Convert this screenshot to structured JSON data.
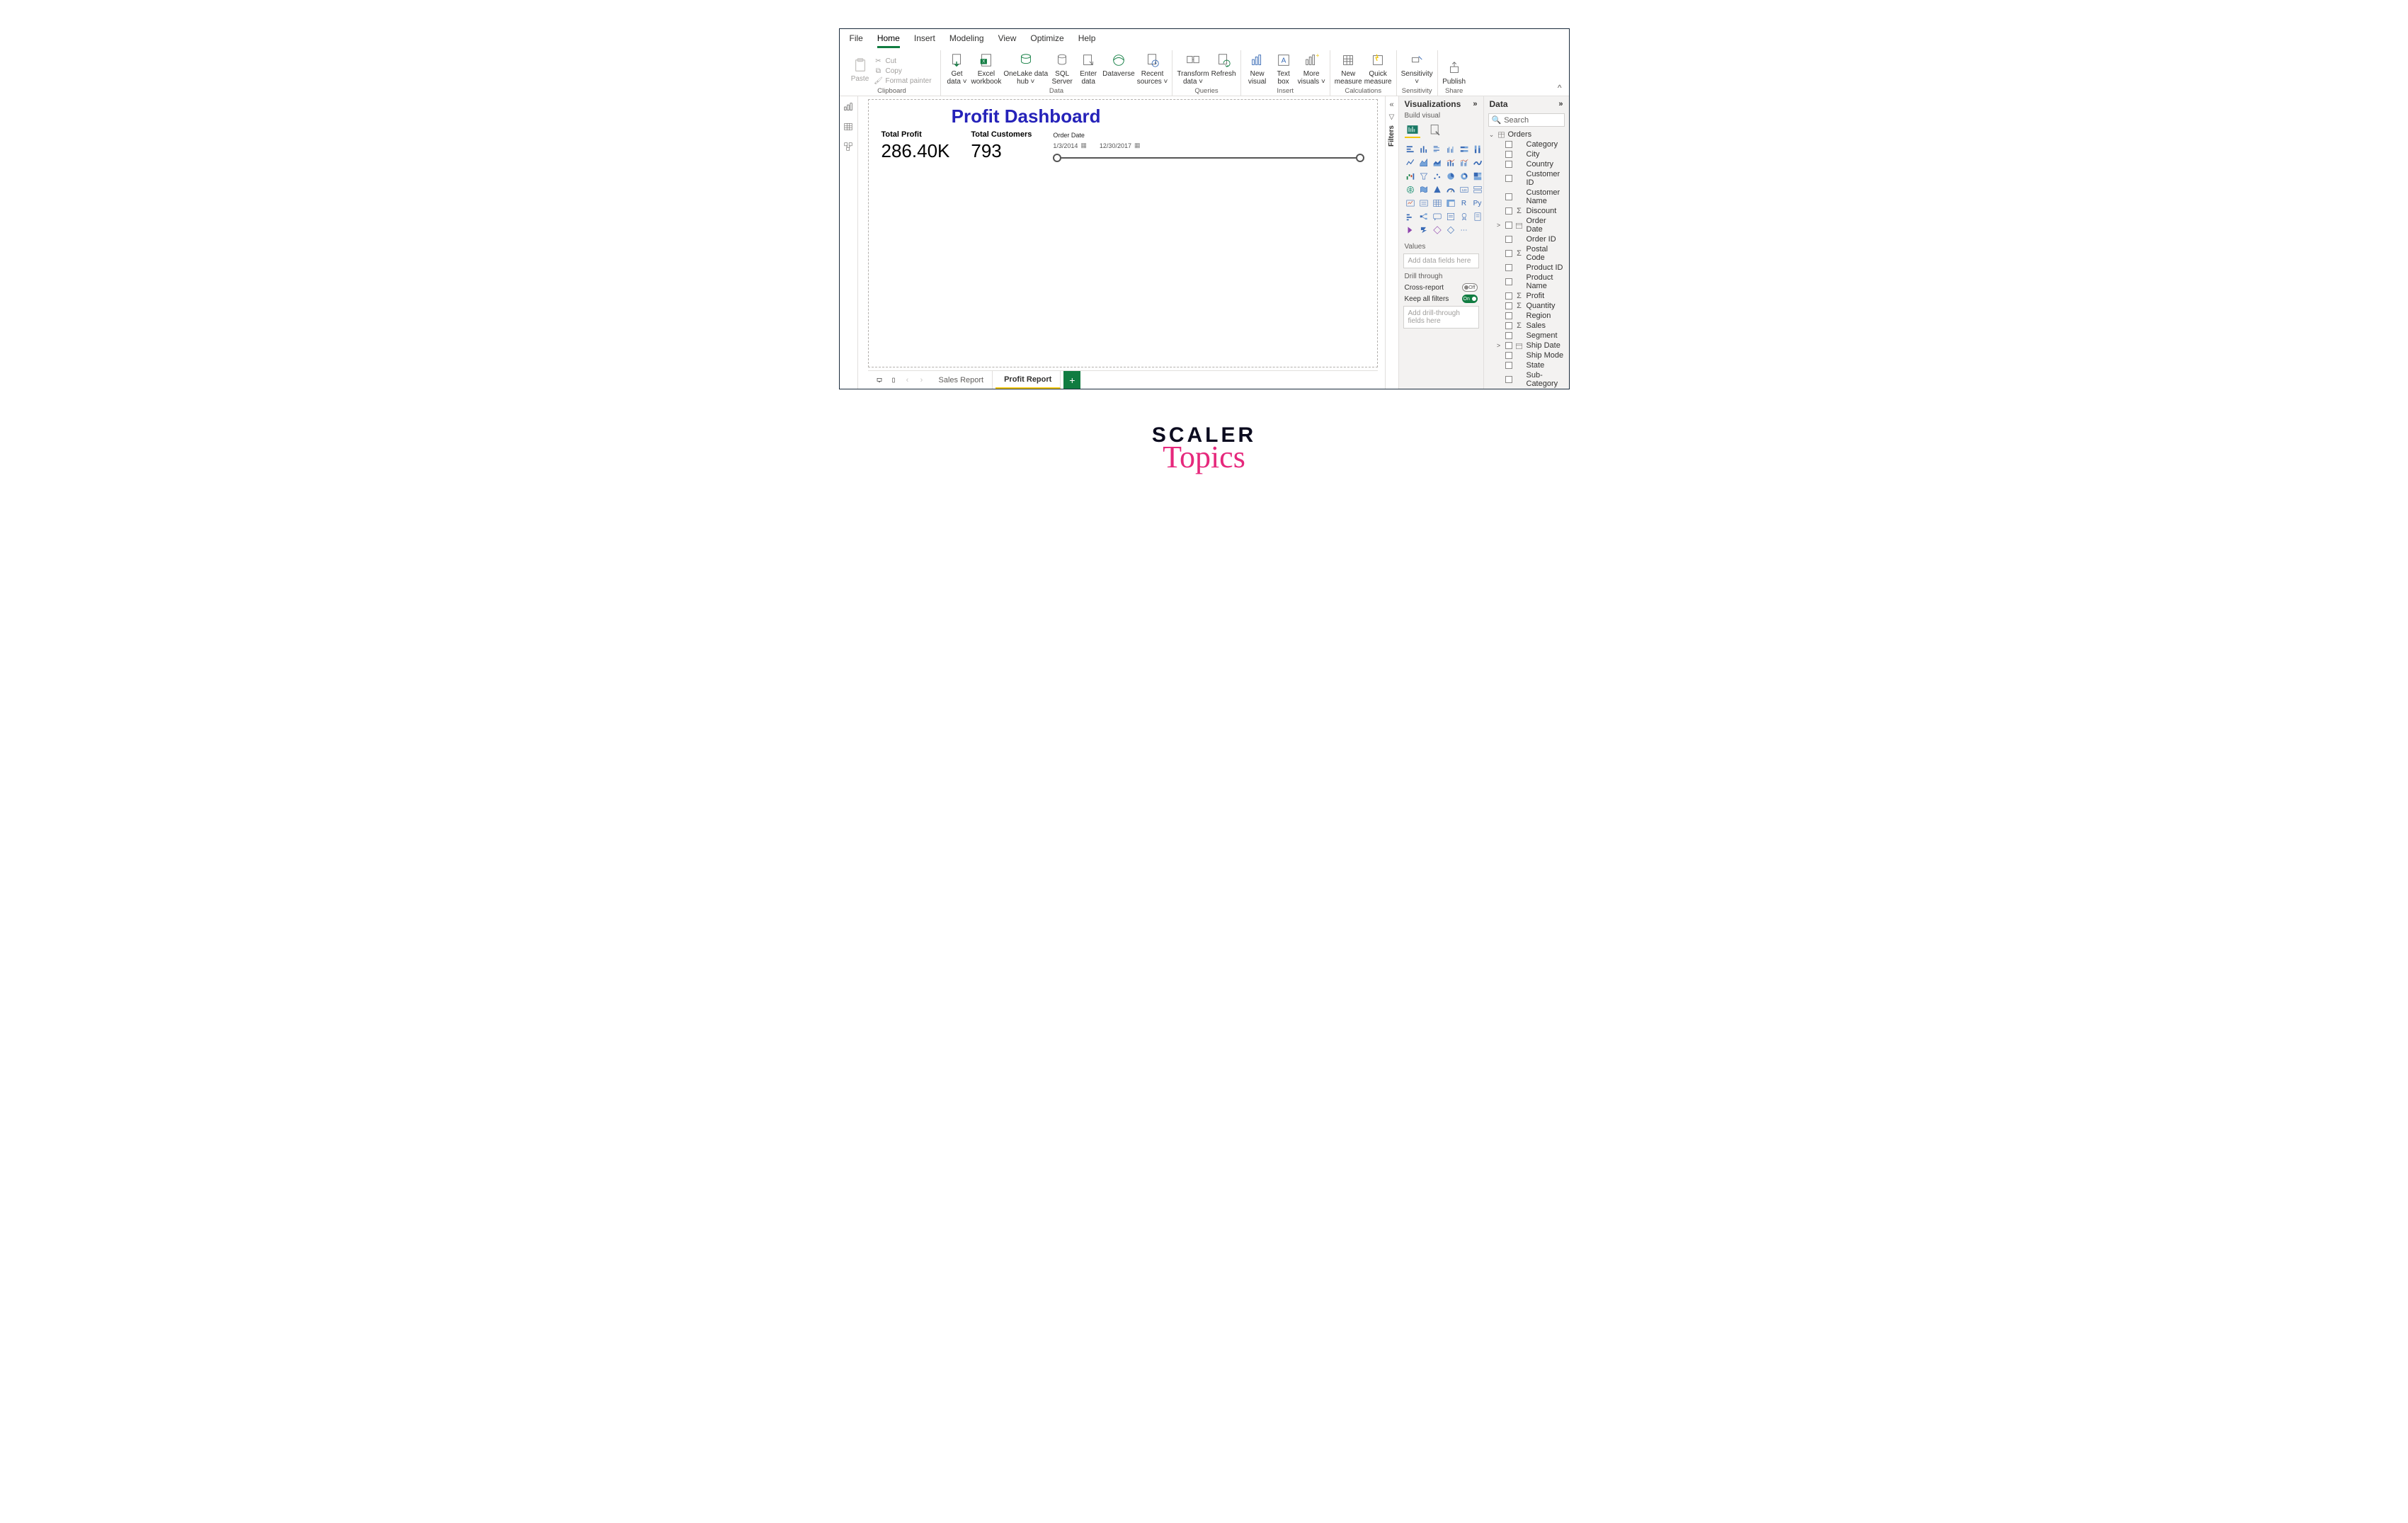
{
  "menu": {
    "tabs": [
      "File",
      "Home",
      "Insert",
      "Modeling",
      "View",
      "Optimize",
      "Help"
    ],
    "active": "Home"
  },
  "ribbon": {
    "clipboard": {
      "paste": "Paste",
      "cut": "Cut",
      "copy": "Copy",
      "formatpainter": "Format painter",
      "group": "Clipboard"
    },
    "data": {
      "get": "Get\ndata ˅",
      "excel": "Excel\nworkbook",
      "onelake": "OneLake data\nhub ˅",
      "sql": "SQL\nServer",
      "enter": "Enter\ndata",
      "dataverse": "Dataverse",
      "recent": "Recent\nsources ˅",
      "group": "Data"
    },
    "queries": {
      "transform": "Transform\ndata ˅",
      "refresh": "Refresh",
      "group": "Queries"
    },
    "insert": {
      "newvisual": "New\nvisual",
      "textbox": "Text\nbox",
      "more": "More\nvisuals ˅",
      "group": "Insert"
    },
    "calc": {
      "newmeasure": "New\nmeasure",
      "quick": "Quick\nmeasure",
      "group": "Calculations"
    },
    "sensitivity": {
      "label": "Sensitivity\n˅",
      "group": "Sensitivity"
    },
    "share": {
      "publish": "Publish",
      "group": "Share"
    }
  },
  "canvas": {
    "title": "Profit Dashboard",
    "kpi1_label": "Total Profit",
    "kpi1_value": "286.40K",
    "kpi2_label": "Total Customers",
    "kpi2_value": "793",
    "slider_title": "Order Date",
    "slider_start": "1/3/2014",
    "slider_end": "12/30/2017"
  },
  "pages": {
    "t1": "Sales Report",
    "t2": "Profit Report"
  },
  "filters": {
    "label": "Filters"
  },
  "viz": {
    "title": "Visualizations",
    "sub": "Build visual",
    "values_label": "Values",
    "values_placeholder": "Add data fields here",
    "drill_label": "Drill through",
    "cross": "Cross-report",
    "cross_state": "Off",
    "keep": "Keep all filters",
    "keep_state": "On",
    "drill_placeholder": "Add drill-through fields here"
  },
  "data": {
    "title": "Data",
    "search_placeholder": "Search",
    "table": "Orders",
    "fields": [
      {
        "name": "Category",
        "icon": ""
      },
      {
        "name": "City",
        "icon": ""
      },
      {
        "name": "Country",
        "icon": ""
      },
      {
        "name": "Customer ID",
        "icon": ""
      },
      {
        "name": "Customer Name",
        "icon": ""
      },
      {
        "name": "Discount",
        "icon": "Σ"
      },
      {
        "name": "Order Date",
        "icon": "date",
        "caret": ">"
      },
      {
        "name": "Order ID",
        "icon": ""
      },
      {
        "name": "Postal Code",
        "icon": "Σ"
      },
      {
        "name": "Product ID",
        "icon": ""
      },
      {
        "name": "Product Name",
        "icon": ""
      },
      {
        "name": "Profit",
        "icon": "Σ"
      },
      {
        "name": "Quantity",
        "icon": "Σ"
      },
      {
        "name": "Region",
        "icon": ""
      },
      {
        "name": "Sales",
        "icon": "Σ"
      },
      {
        "name": "Segment",
        "icon": ""
      },
      {
        "name": "Ship Date",
        "icon": "date",
        "caret": ">"
      },
      {
        "name": "Ship Mode",
        "icon": ""
      },
      {
        "name": "State",
        "icon": ""
      },
      {
        "name": "Sub-Category",
        "icon": ""
      }
    ]
  },
  "watermark": {
    "top": "SCALER",
    "bot": "Topics"
  }
}
